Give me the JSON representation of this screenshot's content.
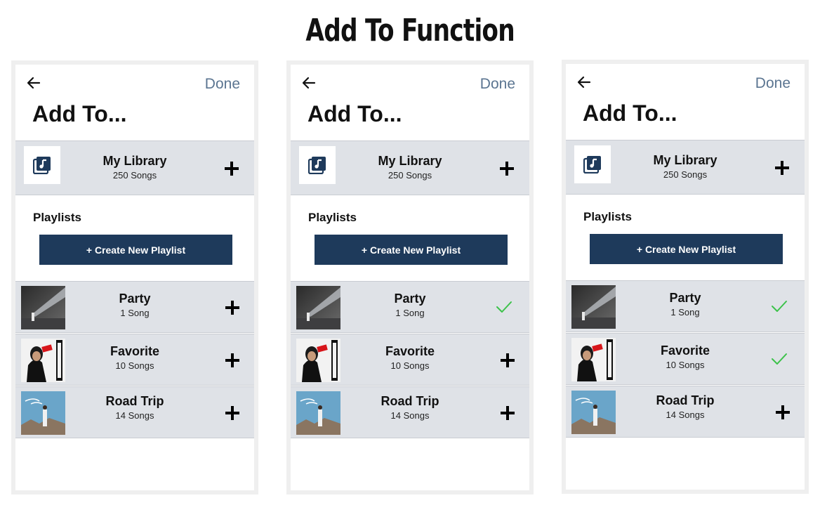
{
  "page_title": "Add To Function",
  "screens": [
    {
      "done_label": "Done",
      "title": "Add To...",
      "library": {
        "name": "My Library",
        "count": "250 Songs",
        "action": "plus"
      },
      "playlists_label": "Playlists",
      "create_label": "+ Create New Playlist",
      "playlists": [
        {
          "name": "Party",
          "count": "1 Song",
          "action": "plus",
          "art": "party-cover"
        },
        {
          "name": "Favorite",
          "count": "10 Songs",
          "action": "plus",
          "art": "bad-cover"
        },
        {
          "name": "Road Trip",
          "count": "14 Songs",
          "action": "plus",
          "art": "roadtrip-cover"
        }
      ]
    },
    {
      "done_label": "Done",
      "title": "Add To...",
      "library": {
        "name": "My Library",
        "count": "250 Songs",
        "action": "plus"
      },
      "playlists_label": "Playlists",
      "create_label": "+ Create New Playlist",
      "playlists": [
        {
          "name": "Party",
          "count": "1 Song",
          "action": "check",
          "art": "party-cover"
        },
        {
          "name": "Favorite",
          "count": "10 Songs",
          "action": "plus",
          "art": "bad-cover"
        },
        {
          "name": "Road Trip",
          "count": "14 Songs",
          "action": "plus",
          "art": "roadtrip-cover"
        }
      ]
    },
    {
      "done_label": "Done",
      "title": "Add To...",
      "library": {
        "name": "My Library",
        "count": "250 Songs",
        "action": "plus"
      },
      "playlists_label": "Playlists",
      "create_label": "+ Create New Playlist",
      "playlists": [
        {
          "name": "Party",
          "count": "1 Song",
          "action": "check",
          "art": "party-cover"
        },
        {
          "name": "Favorite",
          "count": "10 Songs",
          "action": "check",
          "art": "bad-cover"
        },
        {
          "name": "Road Trip",
          "count": "14 Songs",
          "action": "plus",
          "art": "roadtrip-cover"
        }
      ]
    }
  ],
  "colors": {
    "accent_done": "#5b7591",
    "button_bg": "#1e3a5b",
    "row_bg": "#dfe2e7",
    "check_green": "#3cc24a"
  }
}
